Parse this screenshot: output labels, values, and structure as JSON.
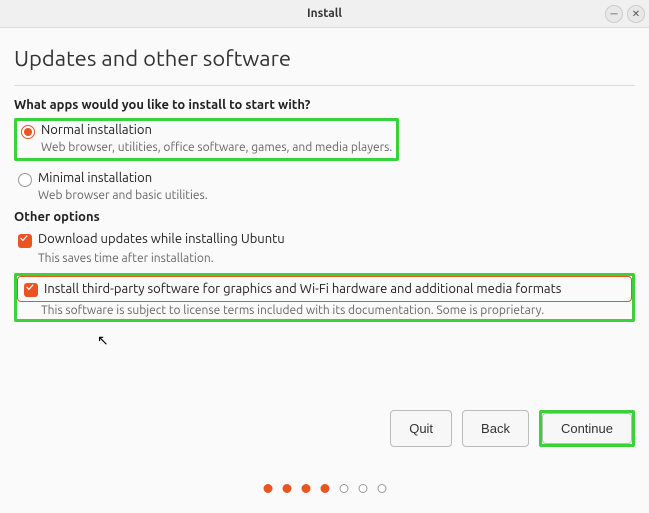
{
  "window": {
    "title": "Install"
  },
  "page": {
    "title": "Updates and other software"
  },
  "q1": "What apps would you like to install to start with?",
  "opt_normal": {
    "label": "Normal installation",
    "desc": "Web browser, utilities, office software, games, and media players."
  },
  "opt_minimal": {
    "label": "Minimal installation",
    "desc": "Web browser and basic utilities."
  },
  "q2": "Other options",
  "opt_updates": {
    "label": "Download updates while installing Ubuntu",
    "desc": "This saves time after installation."
  },
  "opt_thirdparty": {
    "label": "Install third-party software for graphics and Wi-Fi hardware and additional media formats",
    "desc": "This software is subject to license terms included with its documentation. Some is proprietary."
  },
  "buttons": {
    "quit": "Quit",
    "back": "Back",
    "continue": "Continue"
  },
  "progress": {
    "total": 7,
    "current": 4
  }
}
